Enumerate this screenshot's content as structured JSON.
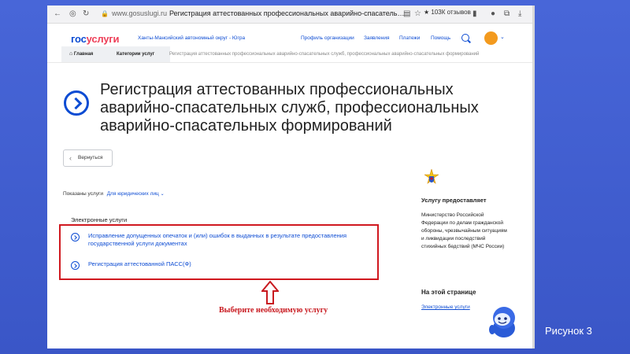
{
  "browser": {
    "url": "www.gosuslugi.ru",
    "tab_title": "Регистрация аттестованных профессиональных аварийно-спасательн...",
    "reviews": "★ 103К отзывов"
  },
  "header": {
    "logo_part1": "гос",
    "logo_part2": "услуги",
    "region": "Ханты-Мансийский автономный округ - Югра",
    "nav": [
      "Профиль организации",
      "Заявления",
      "Платежи",
      "Помощь"
    ]
  },
  "breadcrumbs": [
    "Главная",
    "Категории услуг",
    "Регистрация аттестованных профессиональных аварийно-спасательных служб, профессиональных аварийно-спасательных формирований"
  ],
  "page_title": "Регистрация аттестованных профессиональных аварийно-спасательных служб, профессиональных аварийно-спасательных формирований",
  "back_label": "Вернуться",
  "shown": {
    "label": "Показаны услуги",
    "filter": "Для юридических лиц"
  },
  "electronic": {
    "heading": "Электронные услуги",
    "services": [
      "Исправление допущенных опечаток и (или) ошибок в выданных в результате предоставления государственной услуги документах",
      "Регистрация аттестованной ПАСС(Ф)"
    ]
  },
  "annotation": "Выберите необходимую услугу",
  "provider": {
    "heading": "Услугу предоставляет",
    "text": "Министерство Российской Федерации по делам гражданской обороны, чрезвычайным ситуациям и ликвидации последствий стихийных бедствий (МЧС России)"
  },
  "on_page": {
    "heading": "На этой странице",
    "link": "Электронные услуги"
  },
  "caption": "Рисунок 3",
  "colors": {
    "brand_blue": "#0d4cd3",
    "brand_red": "#ee3f58",
    "highlight_red": "#d0181f",
    "slide_bg": "#4866d8"
  }
}
